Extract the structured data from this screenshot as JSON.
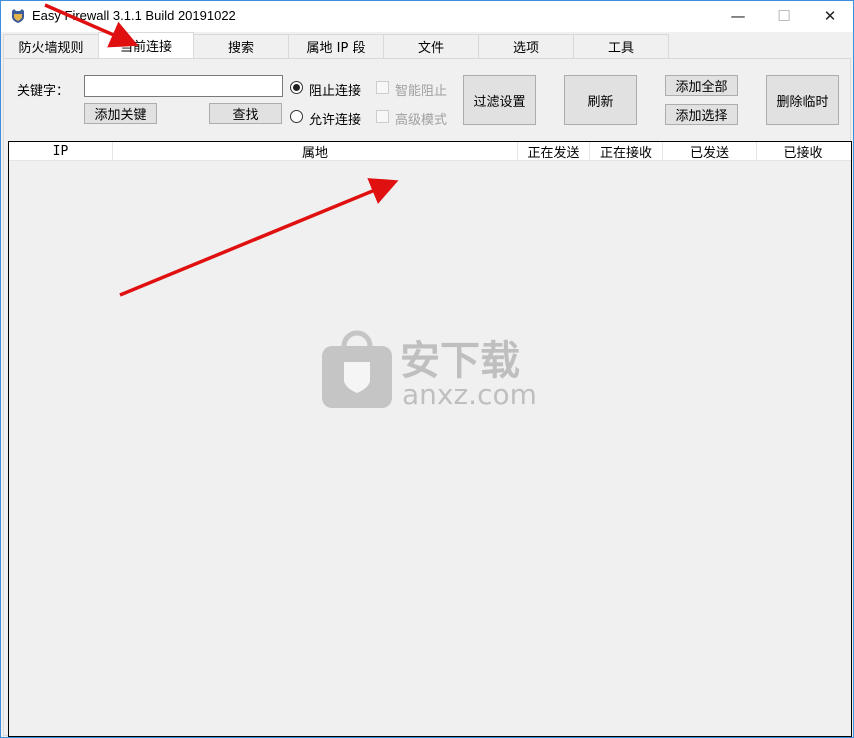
{
  "window": {
    "title": "Easy Firewall 3.1.1 Build 20191022",
    "minimize": "—",
    "maximize": "☐",
    "close": "✕"
  },
  "tabs": [
    {
      "label": "防火墙规则"
    },
    {
      "label": "当前连接",
      "active": true
    },
    {
      "label": "搜索"
    },
    {
      "label": "属地 IP 段"
    },
    {
      "label": "文件"
    },
    {
      "label": "选项"
    },
    {
      "label": "工具"
    }
  ],
  "toolbar": {
    "keyword_label": "关键字：",
    "keyword_value": "",
    "add_keyword": "添加关键",
    "find": "查找",
    "block_label": "阻止连接",
    "allow_label": "允许连接",
    "selected_mode": "block",
    "smart_block": "智能阻止",
    "advanced_mode": "高级模式",
    "filter_settings": "过滤设置",
    "refresh": "刷新",
    "add_all": "添加全部",
    "add_selected": "添加选择",
    "delete_temp": "删除临时"
  },
  "table": {
    "columns": [
      "IP",
      "属地",
      "正在发送",
      "正在接收",
      "已发送",
      "已接收"
    ],
    "rows": []
  },
  "watermark": {
    "text": "安下载",
    "domain": "anxz.com"
  },
  "colors": {
    "arrow": "#e01010",
    "border": "#3c8fd8"
  }
}
